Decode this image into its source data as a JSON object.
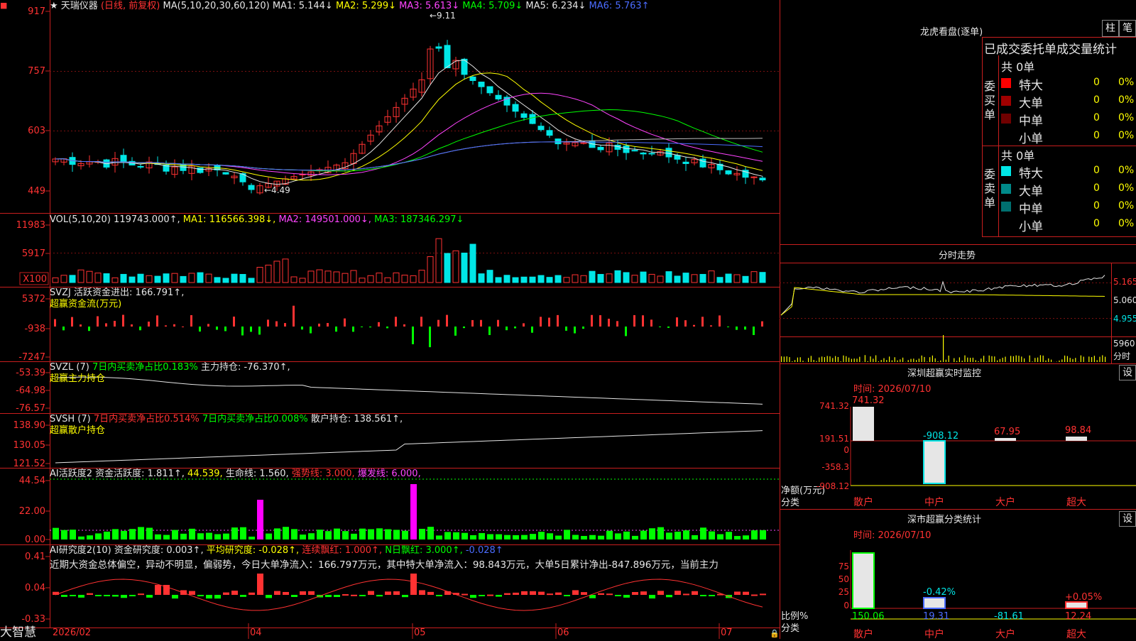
{
  "stock": {
    "star": "★",
    "name": "天瑞仪器",
    "period": "(日线, 前复权)",
    "ma_label": "MA(5,10,20,30,60,120)",
    "ma": [
      {
        "name": "MA1",
        "value": "5.144↓",
        "color": "#e6e6e6"
      },
      {
        "name": "MA2",
        "value": "5.299↓",
        "color": "#ffff00"
      },
      {
        "name": "MA3",
        "value": "5.613↓",
        "color": "#ff44ff"
      },
      {
        "name": "MA4",
        "value": "5.709↓",
        "color": "#00ff00"
      },
      {
        "name": "MA5",
        "value": "6.234↓",
        "color": "#e6e6e6"
      },
      {
        "name": "MA6",
        "value": "5.763↑",
        "color": "#4b6cff"
      }
    ],
    "high_mark": "9.11",
    "low_mark": "4.49",
    "price_axis": [
      "917",
      "757",
      "603",
      "449"
    ]
  },
  "vol": {
    "label": "VOL(5,10,20)",
    "value": "119743.000↑,",
    "ma1": "MA1: 116566.398↓,",
    "ma2": "MA2: 149501.000↓,",
    "ma3": "MA3: 187346.297↓",
    "axis": [
      "11983",
      "5917",
      "X100"
    ]
  },
  "svzj": {
    "label": "SVZJ",
    "text": "活跃资金进出: 166.791↑,",
    "subtitle": "超赢资金流(万元)",
    "axis": [
      "5372",
      "-938",
      "-7247"
    ]
  },
  "svzl": {
    "label": "SVZL (7)",
    "text1": "7日内买卖净占比0.183%",
    "text2": "主力持仓: -76.370↑,",
    "subtitle": "超赢主力持仓",
    "axis": [
      "-53.39",
      "-64.98",
      "-76.57"
    ]
  },
  "svsh": {
    "label": "SVSH (7)",
    "text1": "7日内买卖净占比0.514%",
    "text2": "7日内买卖净占比0.008%",
    "text3": "散户持仓: 138.561↑,",
    "subtitle": "超赢散户持仓",
    "axis": [
      "138.90",
      "130.05",
      "121.52"
    ]
  },
  "ai_huoyue": {
    "label": "AI活跃度2",
    "text1": "资金活跃度: 1.811↑,",
    "text2": "44.539,",
    "text3": "生命线: 1.560,",
    "text4": "强势线: 3.000,",
    "text5": "爆发线: 6.000,",
    "axis": [
      "44.54",
      "22.00",
      "0.00"
    ]
  },
  "ai_yanjiu": {
    "label": "AI研究度2(10)",
    "text1": "资金研究度: 0.003↑,",
    "text2": "平均研究度: -0.028↑,",
    "text3": "连续飘红: 1.000↑,",
    "text4": "N日飘红: 3.000↑,",
    "text5": "-0.028↑",
    "note": "近期大资金总体偏空，异动不明显，偏弱势，今日大单净流入：166.797万元，其中特大单净流入：98.843万元，大单5日累计净出-847.896万元，当前主力",
    "axis": [
      "0.41",
      "0.04",
      "-0.33"
    ]
  },
  "xaxis": {
    "start": "2026/02",
    "ticks": [
      "04",
      "05",
      "06",
      "07"
    ]
  },
  "logo": "大智慧",
  "panel": {
    "title": "龙虎看盘(逐单)",
    "btn1": "柱",
    "btn2": "笔",
    "subtitle": "已成交委托单成交量统计",
    "buy_label": "委买单",
    "sell_label": "委卖单",
    "buy_total": "共 0单",
    "sell_total": "共 0单",
    "buy_rows": [
      {
        "label": "特大",
        "count": "0",
        "pct": "0%",
        "color": "#ff0000"
      },
      {
        "label": "大单",
        "count": "0",
        "pct": "0%",
        "color": "#a00000"
      },
      {
        "label": "中单",
        "count": "0",
        "pct": "0%",
        "color": "#700000"
      },
      {
        "label": "小单",
        "count": "0",
        "pct": "0%",
        "color": "#000000"
      }
    ],
    "sell_rows": [
      {
        "label": "特大",
        "count": "0",
        "pct": "0%",
        "color": "#00e6e6"
      },
      {
        "label": "大单",
        "count": "0",
        "pct": "0%",
        "color": "#008a8a"
      },
      {
        "label": "中单",
        "count": "0",
        "pct": "0%",
        "color": "#007070"
      },
      {
        "label": "小单",
        "count": "0",
        "pct": "0%",
        "color": "#000000"
      }
    ]
  },
  "intraday": {
    "title": "分时走势",
    "axis": [
      "5.165",
      "5.060",
      "4.955"
    ],
    "vol_axis": "5960",
    "vol_unit": "分时"
  },
  "monitor": {
    "title": "深圳超赢实时监控",
    "set": "设",
    "time": "时间: 2026/07/10",
    "axis": [
      "741.32",
      "191.51",
      "0",
      "-358.3",
      "-908.12"
    ],
    "ylabel1": "净额(万元)",
    "ylabel2": "分类",
    "categories": [
      "散户",
      "中户",
      "大户",
      "超大"
    ],
    "values": [
      "741.32",
      "-908.12",
      "67.95",
      "98.84"
    ]
  },
  "classify": {
    "title": "深市超赢分类统计",
    "set": "设",
    "time": "时间: 2026/07/10",
    "axis": [
      "75",
      "50",
      "25",
      "0"
    ],
    "ylabel1": "比例%",
    "ylabel2": "分类",
    "pct_labels": [
      "-0.42%",
      "+0.05%"
    ],
    "categories": [
      "散户",
      "中户",
      "大户",
      "超大"
    ],
    "values": [
      "150.06",
      "19.31",
      "-81.61",
      "12.24"
    ]
  }
}
